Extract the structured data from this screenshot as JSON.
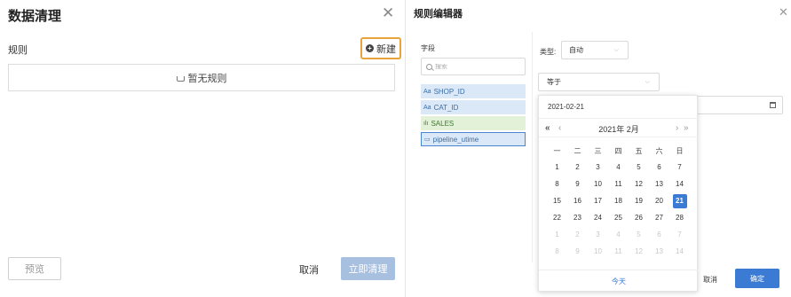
{
  "left": {
    "title": "数据清理",
    "close": "✕",
    "rules_label": "规则",
    "new_button": "新建",
    "empty_text": "暂无规则",
    "preview_button": "预览",
    "cancel_button": "取消",
    "apply_button": "立即清理"
  },
  "right": {
    "title": "规则编辑器",
    "close": "✕",
    "fields_label": "字段",
    "search_placeholder": "搜索",
    "fields": [
      {
        "icon": "Aa",
        "name": "SHOP_ID",
        "kind": "text"
      },
      {
        "icon": "Aa",
        "name": "CAT_ID",
        "kind": "text"
      },
      {
        "icon": "ılı",
        "name": "SALES",
        "kind": "number"
      },
      {
        "icon": "▭",
        "name": "pipeline_utime",
        "kind": "date"
      }
    ],
    "type_label": "类型:",
    "type_value": "自动",
    "operator_value": "等于",
    "cancel_button": "取消",
    "ok_button": "确定"
  },
  "calendar": {
    "input_value": "2021-02-21",
    "title": "2021年 2月",
    "prev_year": "«",
    "prev_month": "‹",
    "next_month": "›",
    "next_year": "»",
    "weekdays": [
      "一",
      "二",
      "三",
      "四",
      "五",
      "六",
      "日"
    ],
    "days": [
      {
        "d": "1",
        "t": "cur"
      },
      {
        "d": "2",
        "t": "cur"
      },
      {
        "d": "3",
        "t": "cur"
      },
      {
        "d": "4",
        "t": "cur"
      },
      {
        "d": "5",
        "t": "cur"
      },
      {
        "d": "6",
        "t": "cur"
      },
      {
        "d": "7",
        "t": "cur"
      },
      {
        "d": "8",
        "t": "cur"
      },
      {
        "d": "9",
        "t": "cur"
      },
      {
        "d": "10",
        "t": "cur"
      },
      {
        "d": "11",
        "t": "cur"
      },
      {
        "d": "12",
        "t": "cur"
      },
      {
        "d": "13",
        "t": "cur"
      },
      {
        "d": "14",
        "t": "cur"
      },
      {
        "d": "15",
        "t": "cur"
      },
      {
        "d": "16",
        "t": "cur"
      },
      {
        "d": "17",
        "t": "cur"
      },
      {
        "d": "18",
        "t": "cur"
      },
      {
        "d": "19",
        "t": "cur"
      },
      {
        "d": "20",
        "t": "cur"
      },
      {
        "d": "21",
        "t": "sel"
      },
      {
        "d": "22",
        "t": "cur"
      },
      {
        "d": "23",
        "t": "cur"
      },
      {
        "d": "24",
        "t": "cur"
      },
      {
        "d": "25",
        "t": "cur"
      },
      {
        "d": "26",
        "t": "cur"
      },
      {
        "d": "27",
        "t": "cur"
      },
      {
        "d": "28",
        "t": "cur"
      },
      {
        "d": "1",
        "t": "other"
      },
      {
        "d": "2",
        "t": "other"
      },
      {
        "d": "3",
        "t": "other"
      },
      {
        "d": "4",
        "t": "other"
      },
      {
        "d": "5",
        "t": "other"
      },
      {
        "d": "6",
        "t": "other"
      },
      {
        "d": "7",
        "t": "other"
      },
      {
        "d": "8",
        "t": "other"
      },
      {
        "d": "9",
        "t": "other"
      },
      {
        "d": "10",
        "t": "other"
      },
      {
        "d": "11",
        "t": "other"
      },
      {
        "d": "12",
        "t": "other"
      },
      {
        "d": "13",
        "t": "other"
      },
      {
        "d": "14",
        "t": "other"
      }
    ],
    "today_button": "今天"
  },
  "colors": {
    "accent": "#3b7bd4",
    "highlight_border": "#e8a33c",
    "disabled_primary": "#a8c0e0"
  }
}
